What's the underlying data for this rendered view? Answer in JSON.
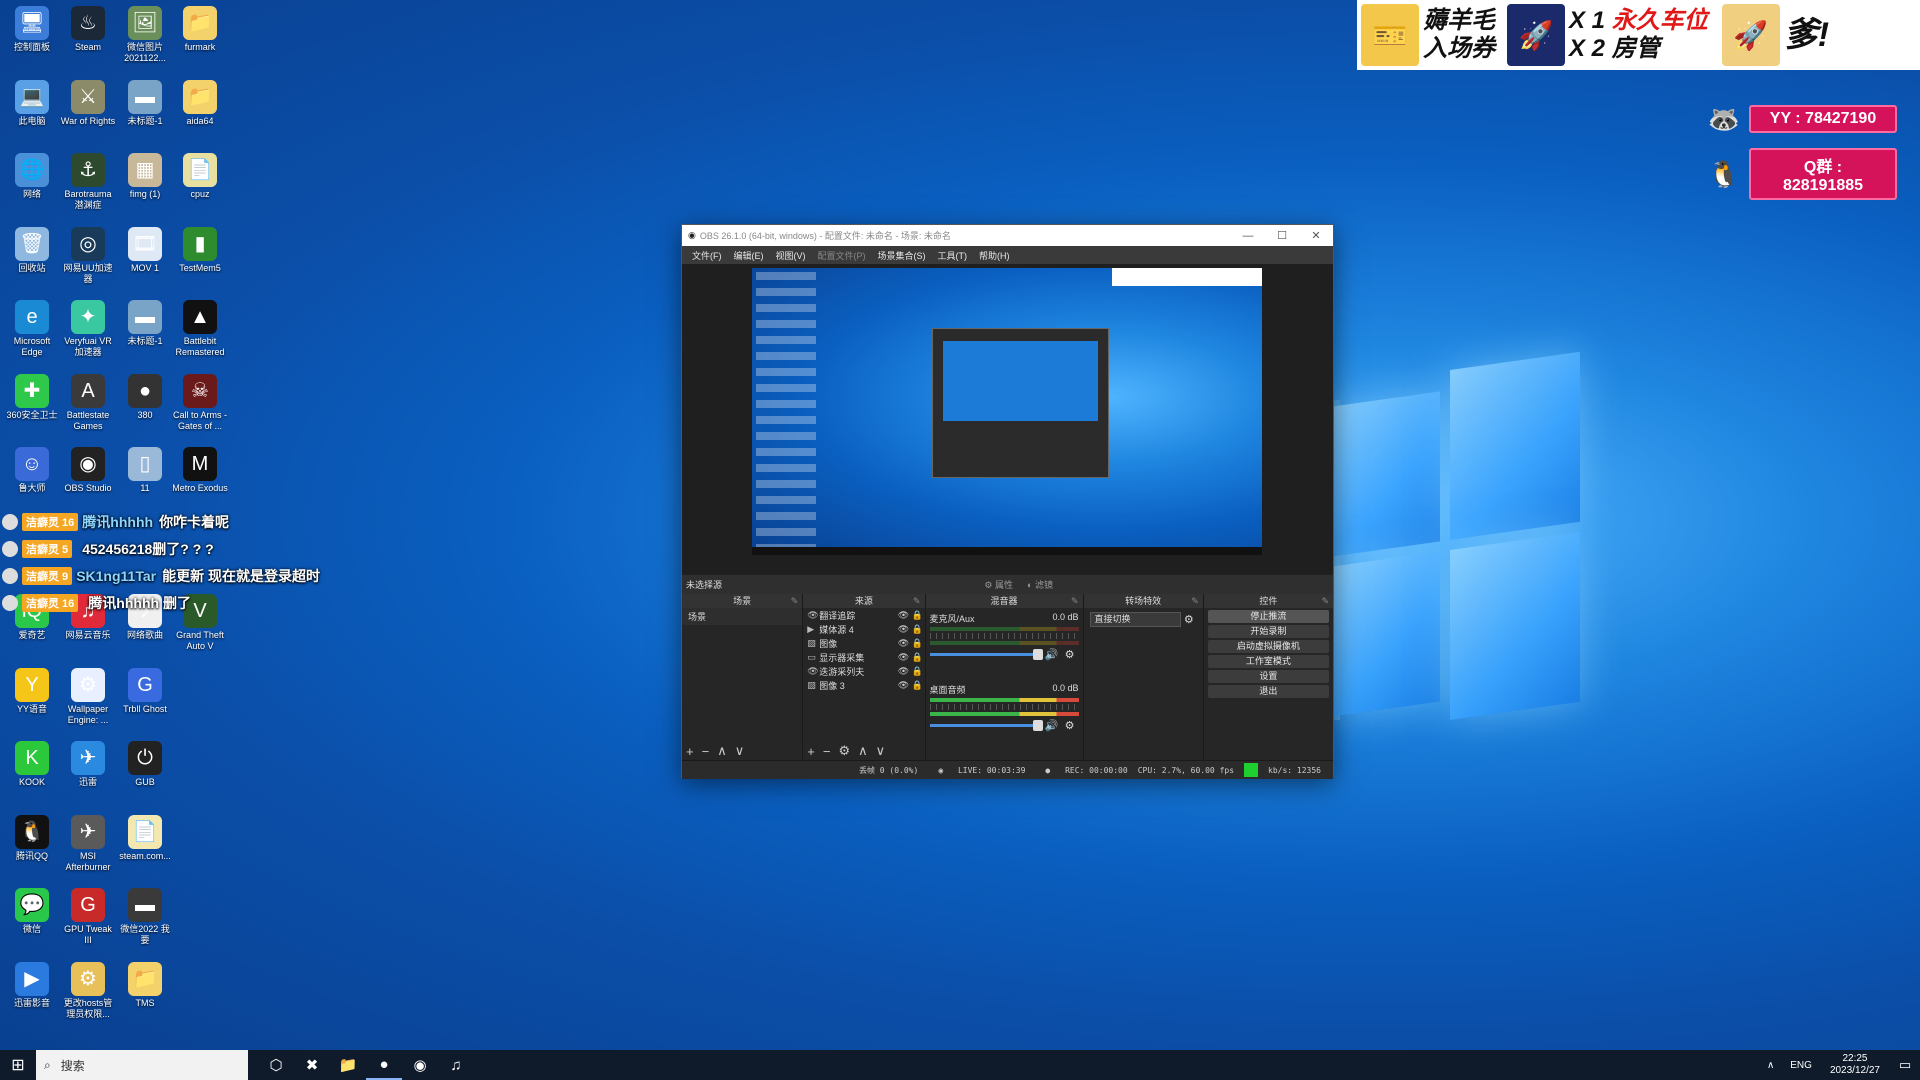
{
  "desktop_icons": [
    {
      "label": "控制面板",
      "glyph": "🖥",
      "color": "#3b7dd8",
      "col": 0,
      "row": 0
    },
    {
      "label": "Steam",
      "glyph": "♨",
      "color": "#1b2838",
      "col": 1,
      "row": 0
    },
    {
      "label": "微信图片 2021122...",
      "glyph": "🖼",
      "color": "#6b8f5a",
      "col": 2,
      "row": 0
    },
    {
      "label": "furmark",
      "glyph": "📁",
      "color": "#f3d26b",
      "col": 3,
      "row": 0
    },
    {
      "label": "此电脑",
      "glyph": "💻",
      "color": "#5aa0e6",
      "col": 0,
      "row": 1
    },
    {
      "label": "War of Rights",
      "glyph": "⚔",
      "color": "#8b8b6a",
      "col": 1,
      "row": 1
    },
    {
      "label": "未标题-1",
      "glyph": "▬",
      "color": "#7aa3c8",
      "col": 2,
      "row": 1
    },
    {
      "label": "aida64",
      "glyph": "📁",
      "color": "#f3d26b",
      "col": 3,
      "row": 1
    },
    {
      "label": "网络",
      "glyph": "🌐",
      "color": "#4a90d9",
      "col": 0,
      "row": 2
    },
    {
      "label": "Barotrauma 潜渊症",
      "glyph": "⚓",
      "color": "#2e4a2e",
      "col": 1,
      "row": 2
    },
    {
      "label": "fimg (1)",
      "glyph": "▦",
      "color": "#c8b89a",
      "col": 2,
      "row": 2
    },
    {
      "label": "cpuz",
      "glyph": "📄",
      "color": "#e8e0a0",
      "col": 3,
      "row": 2
    },
    {
      "label": "回收站",
      "glyph": "🗑",
      "color": "#8fb8e0",
      "col": 0,
      "row": 3
    },
    {
      "label": "网易UU加速器",
      "glyph": "◎",
      "color": "#1a3a5a",
      "col": 1,
      "row": 3
    },
    {
      "label": "MOV 1",
      "glyph": "🎞",
      "color": "#dfe8f5",
      "col": 2,
      "row": 3
    },
    {
      "label": "TestMem5",
      "glyph": "▮",
      "color": "#2e8b2e",
      "col": 3,
      "row": 3
    },
    {
      "label": "Microsoft Edge",
      "glyph": "e",
      "color": "#1a8ad4",
      "col": 0,
      "row": 4
    },
    {
      "label": "Veryfuai VR 加速器",
      "glyph": "✦",
      "color": "#3ac8a0",
      "col": 1,
      "row": 4
    },
    {
      "label": "未标题-1",
      "glyph": "▬",
      "color": "#7aa3c8",
      "col": 2,
      "row": 4
    },
    {
      "label": "Battlebit Remastered",
      "glyph": "▲",
      "color": "#111111",
      "col": 3,
      "row": 4
    },
    {
      "label": "360安全卫士",
      "glyph": "✚",
      "color": "#2ec84a",
      "col": 0,
      "row": 5
    },
    {
      "label": "Battlestate Games Launcher",
      "glyph": "A",
      "color": "#3a3a3a",
      "col": 1,
      "row": 5
    },
    {
      "label": "380",
      "glyph": "●",
      "color": "#333333",
      "col": 2,
      "row": 5
    },
    {
      "label": "Call to Arms - Gates of ...",
      "glyph": "☠",
      "color": "#6a1a1a",
      "col": 3,
      "row": 5
    },
    {
      "label": "鲁大师",
      "glyph": "☺",
      "color": "#3a6ad8",
      "col": 0,
      "row": 6
    },
    {
      "label": "OBS Studio",
      "glyph": "◉",
      "color": "#222222",
      "col": 1,
      "row": 6
    },
    {
      "label": "11",
      "glyph": "▯",
      "color": "#9ab8d8",
      "col": 2,
      "row": 6
    },
    {
      "label": "Metro Exodus",
      "glyph": "M",
      "color": "#111111",
      "col": 3,
      "row": 6
    },
    {
      "label": "爱奇艺",
      "glyph": "iQ",
      "color": "#2ac84a",
      "col": 0,
      "row": 8
    },
    {
      "label": "网易云音乐",
      "glyph": "♫",
      "color": "#e02a3a",
      "col": 1,
      "row": 8
    },
    {
      "label": "网络歌曲",
      "glyph": "♪",
      "color": "#f0f0f0",
      "col": 2,
      "row": 8
    },
    {
      "label": "Grand Theft Auto V",
      "glyph": "V",
      "color": "#2a5a2a",
      "col": 3,
      "row": 8
    },
    {
      "label": "YY语音",
      "glyph": "Y",
      "color": "#f5c518",
      "col": 0,
      "row": 9
    },
    {
      "label": "Wallpaper Engine: ...",
      "glyph": "⚙",
      "color": "#e8f0ff",
      "col": 1,
      "row": 9
    },
    {
      "label": "Trbll Ghost",
      "glyph": "G",
      "color": "#3a6ae0",
      "col": 2,
      "row": 9
    },
    {
      "label": "KOOK",
      "glyph": "K",
      "color": "#2ac83a",
      "col": 0,
      "row": 10
    },
    {
      "label": "迅雷",
      "glyph": "✈",
      "color": "#2a8ae0",
      "col": 1,
      "row": 10
    },
    {
      "label": "GUB",
      "glyph": "⏻",
      "color": "#222222",
      "col": 2,
      "row": 10
    },
    {
      "label": "腾讯QQ",
      "glyph": "🐧",
      "color": "#111111",
      "col": 0,
      "row": 11
    },
    {
      "label": "MSI Afterburner",
      "glyph": "✈",
      "color": "#5a5a5a",
      "col": 1,
      "row": 11
    },
    {
      "label": "steam.com...",
      "glyph": "📄",
      "color": "#f3e9b0",
      "col": 2,
      "row": 11
    },
    {
      "label": "微信",
      "glyph": "💬",
      "color": "#2ac84a",
      "col": 0,
      "row": 12
    },
    {
      "label": "GPU Tweak III",
      "glyph": "G",
      "color": "#c82a2a",
      "col": 1,
      "row": 12
    },
    {
      "label": "微信2022 我要",
      "glyph": "▬",
      "color": "#3a3a3a",
      "col": 2,
      "row": 12
    },
    {
      "label": "迅雷影音",
      "glyph": "▶",
      "color": "#2a7ae0",
      "col": 0,
      "row": 13
    },
    {
      "label": "更改hosts管 理员权限...",
      "glyph": "⚙",
      "color": "#e8c05a",
      "col": 1,
      "row": 13
    },
    {
      "label": "TMS",
      "glyph": "📁",
      "color": "#f3d26b",
      "col": 2,
      "row": 13
    }
  ],
  "banner": {
    "ticket_line1": "薅羊毛",
    "ticket_line2": "入场券",
    "x1_label": "X 1",
    "x1_text": "永久车位",
    "x2_label": "X 2",
    "x2_text": "房管",
    "tail": "爹!"
  },
  "badges": [
    {
      "label": "YY : 78427190",
      "face": "🦝"
    },
    {
      "label": "Q群 : 828191885",
      "face": "🐧"
    }
  ],
  "chat": [
    {
      "level": "洁癖灵 16",
      "name": "腾讯hhhhh",
      "msg": "你咋卡着呢"
    },
    {
      "level": "洁癖灵 5",
      "name": "",
      "msg": "452456218删了? ? ?"
    },
    {
      "level": "洁癖灵 9",
      "name": "SK1ng11Tar",
      "msg": "能更新 现在就是登录超时"
    },
    {
      "level": "洁癖灵 16",
      "name": "",
      "msg": "腾讯hhhhh 删了"
    }
  ],
  "obs": {
    "title": "OBS 26.1.0 (64-bit, windows) - 配置文件: 未命名 - 场景: 未命名",
    "menu": [
      {
        "label": "文件(F)",
        "dim": false
      },
      {
        "label": "编辑(E)",
        "dim": false
      },
      {
        "label": "视图(V)",
        "dim": false
      },
      {
        "label": "配置文件(P)",
        "dim": true
      },
      {
        "label": "场景集合(S)",
        "dim": false
      },
      {
        "label": "工具(T)",
        "dim": false
      },
      {
        "label": "帮助(H)",
        "dim": false
      }
    ],
    "scene_bar_label": "未选择源",
    "props_label": "属性",
    "filters_label": "滤镜",
    "docks": {
      "scenes_title": "场景",
      "sources_title": "来源",
      "mixer_title": "混音器",
      "transitions_title": "转场特效",
      "controls_title": "控件"
    },
    "scenes": [
      "场景"
    ],
    "sources": [
      {
        "icon": "👁",
        "name": "翻译追踪"
      },
      {
        "icon": "▶",
        "name": "媒体源 4"
      },
      {
        "icon": "▨",
        "name": "图像"
      },
      {
        "icon": "▭",
        "name": "显示器采集"
      },
      {
        "icon": "👁",
        "name": "迭游采列夫"
      },
      {
        "icon": "▨",
        "name": "图像 3"
      }
    ],
    "mixer": [
      {
        "name": "麦克风/Aux",
        "db": "0.0 dB",
        "active": false
      },
      {
        "name": "桌面音频",
        "db": "0.0 dB",
        "active": true
      }
    ],
    "transition_value": "直接切换",
    "controls": [
      {
        "label": "停止推流",
        "active": true
      },
      {
        "label": "开始录制",
        "active": false
      },
      {
        "label": "启动虚拟摄像机",
        "active": false
      },
      {
        "label": "工作室模式",
        "active": false
      },
      {
        "label": "设置",
        "active": false
      },
      {
        "label": "退出",
        "active": false
      }
    ],
    "status": {
      "dropped": "丢帧 0 (0.0%)",
      "live": "LIVE: 00:03:39",
      "rec": "REC: 00:00:00",
      "cpu": "CPU: 2.7%, 60.00 fps",
      "kbps": "kb/s: 12356"
    }
  },
  "taskbar": {
    "search_placeholder": "搜索",
    "apps": [
      "⬡",
      "✖",
      "📁",
      "●",
      "◉",
      "♫"
    ],
    "lang": "ENG",
    "time": "22:25",
    "date": "2023/12/27"
  }
}
